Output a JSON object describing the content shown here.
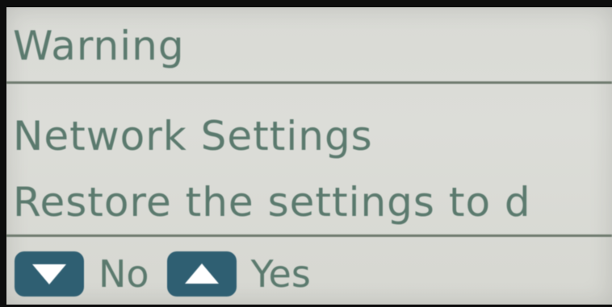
{
  "screen": {
    "title": "Warning",
    "line1": "Network Settings",
    "line2": "Restore the settings to d",
    "options": [
      {
        "key_icon": "down-triangle-icon",
        "label": "No"
      },
      {
        "key_icon": "up-triangle-icon",
        "label": "Yes"
      }
    ],
    "colors": {
      "lcd_bg": "#d9dad5",
      "text": "#5b7a6e",
      "key_bg": "#2f5f72"
    }
  }
}
